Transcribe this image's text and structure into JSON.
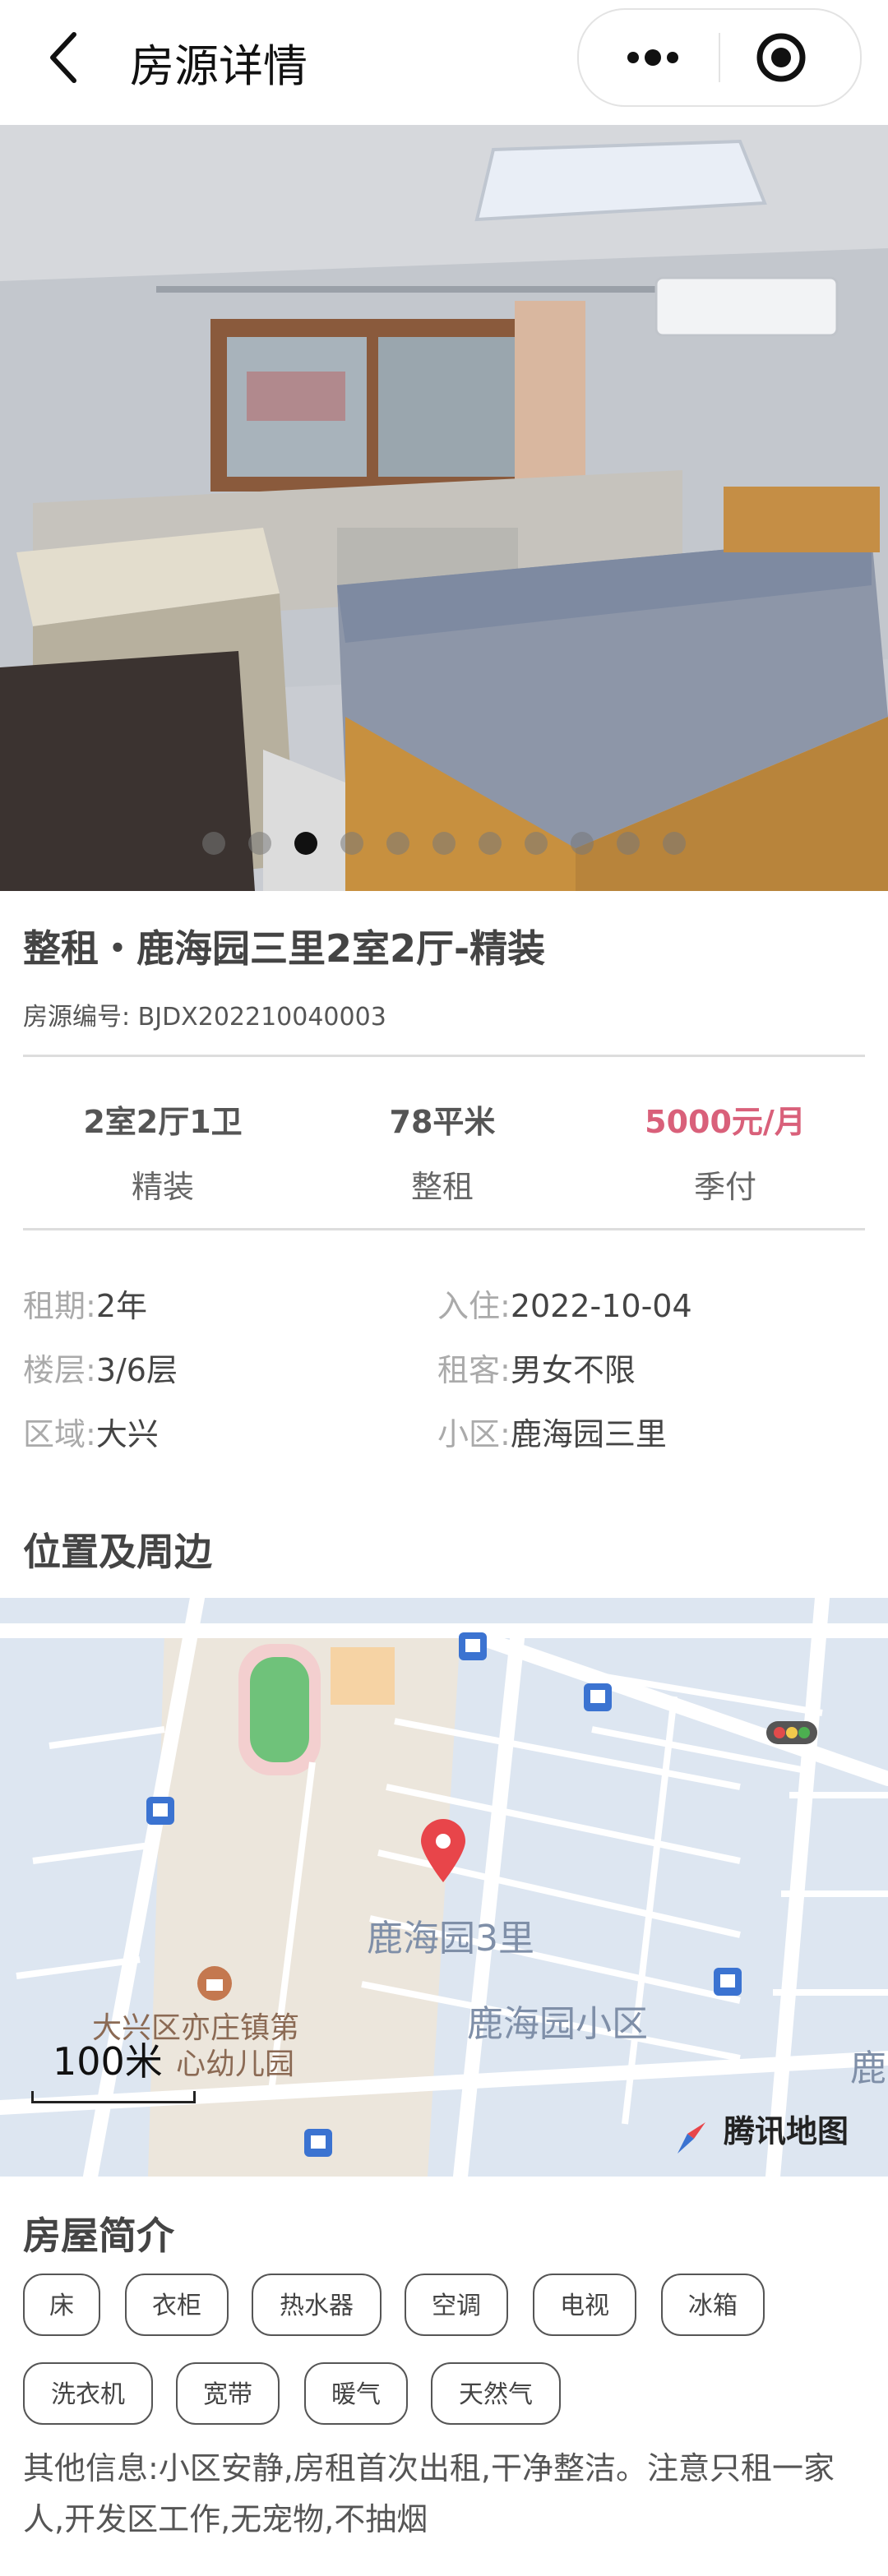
{
  "navbar": {
    "title": "房源详情"
  },
  "gallery": {
    "active_index": 2,
    "count": 11
  },
  "house": {
    "title": "整租・鹿海园三里2室2厅-精装",
    "code_label": "房源编号:",
    "code": "BJDX202210040003"
  },
  "stats": {
    "layout": "2室2厅1卫",
    "decoration": "精装",
    "area": "78平米",
    "rent_type": "整租",
    "price": "5000元/月",
    "payment": "季付"
  },
  "details": {
    "lease_label": "租期:",
    "lease": "2年",
    "movein_label": "入住:",
    "movein": "2022-10-04",
    "floor_label": "楼层:",
    "floor": "3/6层",
    "tenant_label": "租客:",
    "tenant": "男女不限",
    "district_label": "区域:",
    "district": "大兴",
    "community_label": "小区:",
    "community": "鹿海园三里"
  },
  "location": {
    "title": "位置及周边",
    "map_label_1": "鹿海园3里",
    "map_label_2": "鹿海园小区",
    "map_label_3": "鹿",
    "map_poi_line1": "大兴区亦庄镇第",
    "map_poi_line2": "心幼儿园",
    "scale": "100米",
    "map_provider": "腾讯地图"
  },
  "intro": {
    "title": "房屋简介",
    "tags": [
      "床",
      "衣柜",
      "热水器",
      "空调",
      "电视",
      "冰箱",
      "洗衣机",
      "宽带",
      "暖气",
      "天然气"
    ],
    "other_info": "其他信息:小区安静,房租首次出租,干净整洁。注意只租一家人,开发区工作,无宠物,不抽烟"
  },
  "colors": {
    "price": "#d9607a",
    "map_road": "#ffffff",
    "map_block": "#dde6f1",
    "map_marker": "#e8454a"
  },
  "icons": [
    "back-icon",
    "more-icon",
    "target-icon",
    "map-marker-icon",
    "bus-stop-icon",
    "traffic-light-icon",
    "school-icon",
    "compass-icon"
  ]
}
